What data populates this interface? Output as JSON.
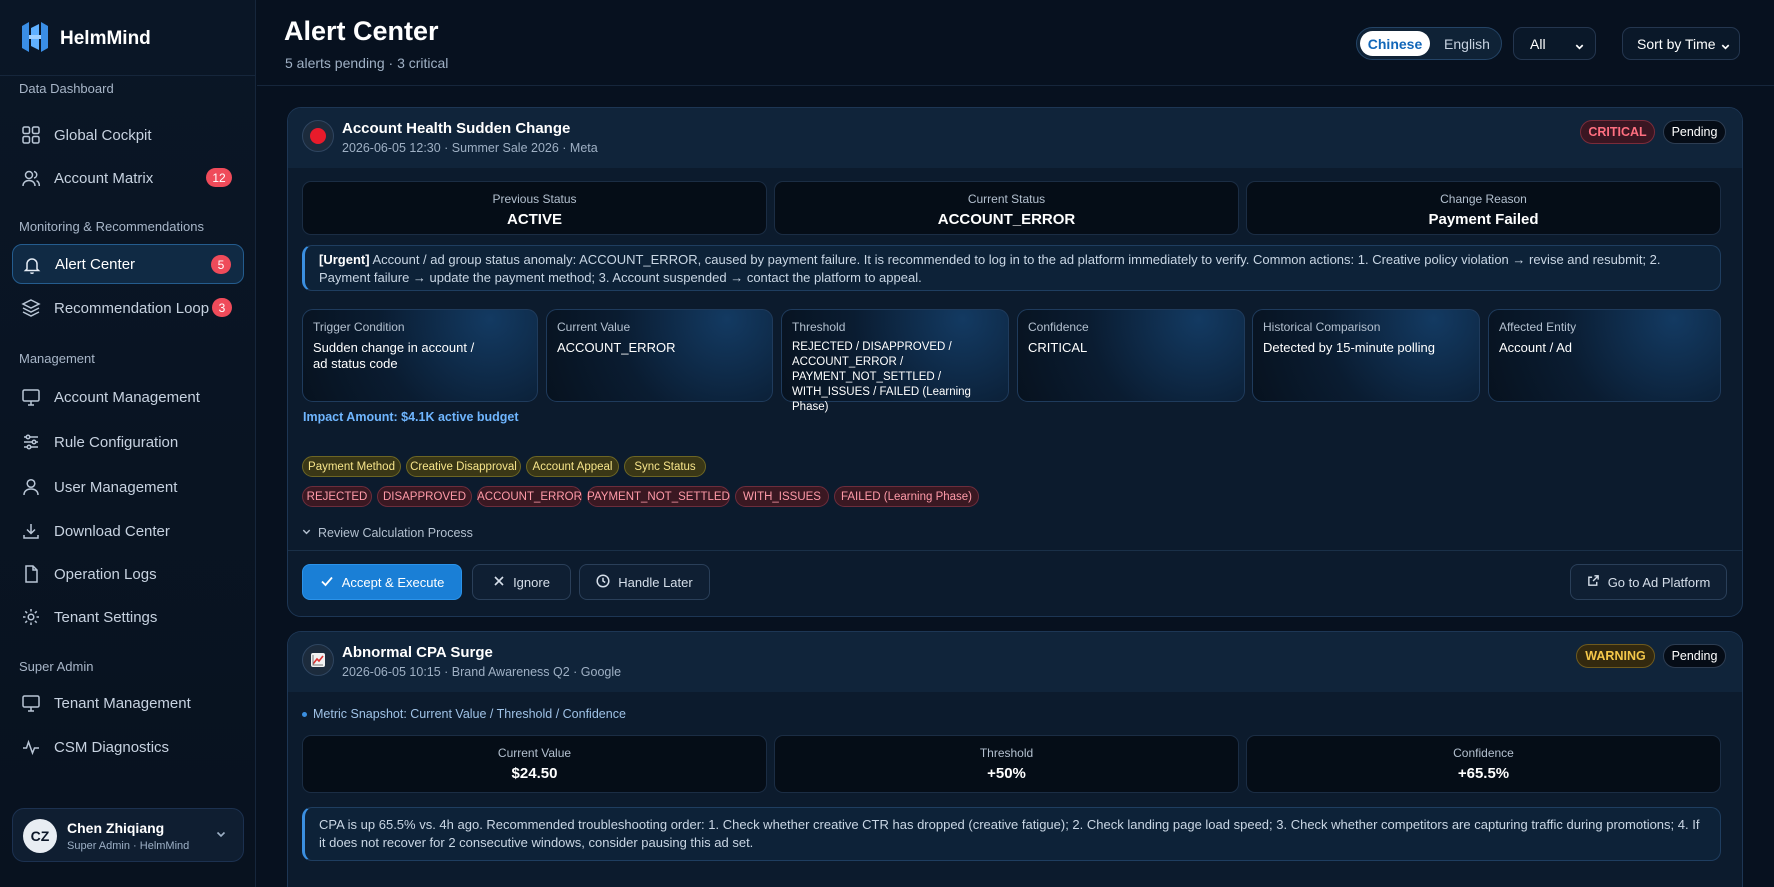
{
  "brand": {
    "name": "HelmMind"
  },
  "sidebar": {
    "sections": [
      {
        "title": "Data Dashboard",
        "items": [
          {
            "label": "Global Cockpit",
            "icon": "grid-icon"
          },
          {
            "label": "Account Matrix",
            "icon": "users-icon",
            "badge": "12"
          }
        ]
      },
      {
        "title": "Monitoring & Recommendations",
        "items": [
          {
            "label": "Alert Center",
            "icon": "bell-icon",
            "badge": "5",
            "active": true
          },
          {
            "label": "Recommendation Loop",
            "icon": "layers-icon",
            "badge": "3"
          }
        ]
      },
      {
        "title": "Management",
        "items": [
          {
            "label": "Account Management",
            "icon": "monitor-icon"
          },
          {
            "label": "Rule Configuration",
            "icon": "sliders-icon"
          },
          {
            "label": "User Management",
            "icon": "user-icon"
          },
          {
            "label": "Download Center",
            "icon": "download-icon"
          },
          {
            "label": "Operation Logs",
            "icon": "file-icon"
          },
          {
            "label": "Tenant Settings",
            "icon": "gear-icon"
          }
        ]
      },
      {
        "title": "Super Admin",
        "items": [
          {
            "label": "Tenant Management",
            "icon": "monitor-icon"
          },
          {
            "label": "CSM Diagnostics",
            "icon": "activity-icon"
          }
        ]
      }
    ],
    "user": {
      "initials": "CZ",
      "name": "Chen Zhiqiang",
      "role": "Super Admin · HelmMind"
    }
  },
  "header": {
    "title": "Alert Center",
    "subtitle": "5 alerts pending · 3 critical",
    "lang_active": "Chinese",
    "lang_other": "English",
    "filter_value": "All",
    "sort_value": "Sort by Time"
  },
  "alerts": [
    {
      "title": "Account Health Sudden Change",
      "meta": "2026-06-05 12:30 · Summer Sale 2026 · Meta",
      "severity": "CRITICAL",
      "status": "Pending",
      "stats": [
        {
          "label": "Previous Status",
          "value": "ACTIVE"
        },
        {
          "label": "Current Status",
          "value": "ACCOUNT_ERROR"
        },
        {
          "label": "Change Reason",
          "value": "Payment Failed"
        }
      ],
      "note_tag": "[Urgent]",
      "note_text": "Account / ad group status anomaly: ACCOUNT_ERROR, caused by payment failure. It is recommended to log in to the ad platform immediately to verify. Common actions: 1. Creative policy violation → revise and resubmit; 2. Payment failure → update the payment method; 3. Account suspended → contact the platform to appeal.",
      "metrics": [
        {
          "label": "Trigger Condition",
          "value": "Sudden change in account / ad status code"
        },
        {
          "label": "Current Value",
          "value": "ACCOUNT_ERROR"
        },
        {
          "label": "Threshold",
          "value": "REJECTED / DISAPPROVED / ACCOUNT_ERROR / PAYMENT_NOT_SETTLED / WITH_ISSUES / FAILED (Learning Phase)"
        },
        {
          "label": "Confidence",
          "value": "CRITICAL"
        },
        {
          "label": "Historical Comparison",
          "value": "Detected by 15-minute polling"
        },
        {
          "label": "Affected Entity",
          "value": "Account / Ad"
        }
      ],
      "impact": "Impact Amount: $4.1K active budget",
      "tags_yellow": [
        "Payment Method",
        "Creative Disapproval",
        "Account Appeal",
        "Sync Status"
      ],
      "tags_red": [
        "REJECTED",
        "DISAPPROVED",
        "ACCOUNT_ERROR",
        "PAYMENT_NOT_SETTLED",
        "WITH_ISSUES",
        "FAILED (Learning Phase)"
      ],
      "review_label": "Review Calculation Process",
      "actions": {
        "accept": "Accept & Execute",
        "ignore": "Ignore",
        "later": "Handle Later",
        "goto": "Go to Ad Platform"
      }
    },
    {
      "title": "Abnormal CPA Surge",
      "meta": "2026-06-05 10:15 · Brand Awareness Q2 · Google",
      "severity": "WARNING",
      "status": "Pending",
      "snapshot_label": "Metric Snapshot: Current Value / Threshold / Confidence",
      "stats": [
        {
          "label": "Current Value",
          "value": "$24.50"
        },
        {
          "label": "Threshold",
          "value": "+50%"
        },
        {
          "label": "Confidence",
          "value": "+65.5%"
        }
      ],
      "note_text": "CPA is up 65.5% vs. 4h ago. Recommended troubleshooting order: 1. Check whether creative CTR has dropped (creative fatigue); 2. Check landing page load speed; 3. Check whether competitors are capturing traffic during promotions; 4. If it does not recover for 2 consecutive windows, consider pausing this ad set."
    }
  ]
}
